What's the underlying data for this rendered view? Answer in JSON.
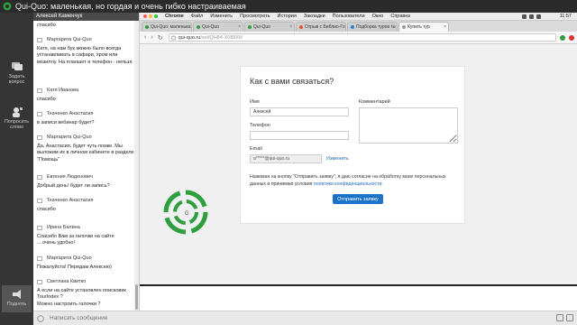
{
  "webinar": {
    "title": "Qui-Quo: маленькая, но гордая и очень гибко настраиваемая",
    "brand_color": "#2e9f3e"
  },
  "left_tools": {
    "ask_label": "Задать вопрос",
    "speak_label": "Попросить слово",
    "raise_label": "Поднять"
  },
  "chat": {
    "header": "Алексей Каменчук",
    "messages": [
      {
        "name": "",
        "text": "спасибо"
      },
      {
        "name": "Маргарита Qui-Quo",
        "text": "Катя, на нам бук можно было всегда устанавливать в сафари, хром или мозиллу. На планшет и телефон - нельзя."
      },
      {
        "name": "Катя Иванова",
        "text": "спасибо"
      },
      {
        "name": "Ткаченко Анастасия",
        "text": "в записи вебинар будет?"
      },
      {
        "name": "Маргарита Qui-Quo",
        "text": "Да, Анастасия, будет чуть позже. Мы выложим их в личном кабинете в разделе \"Помощь\""
      },
      {
        "name": "Евгения Люденович",
        "text": "Добрый день! будет ли запись?"
      },
      {
        "name": "Ткаченко Анастасия",
        "text": "спасибо"
      },
      {
        "name": "Ирина Балина",
        "text": "Спасибо Вам за галочки на сайте ....очень удобно!"
      },
      {
        "name": "Маргарита Qui-Quo",
        "text": "Пожалуйста! Передам Алексею)"
      },
      {
        "name": "Светлана Квитко",
        "text": "А если на сайте установлен поисковик TourIndex ?"
      },
      {
        "name": "",
        "text": "Можно настроить галочки ?"
      }
    ],
    "input_placeholder": "Написать сообщение"
  },
  "browser": {
    "menu": [
      "Chrome",
      "Файл",
      "Изменить",
      "Просмотреть",
      "История",
      "Закладки",
      "Пользователи",
      "Окно",
      "Справка"
    ],
    "clock": "11:57",
    "tabs": [
      {
        "label": "Qui-Quo: маленька",
        "color": "#2e9f3e"
      },
      {
        "label": "Qui-Quo",
        "color": "#2e9f3e"
      },
      {
        "label": "Qui-Quo",
        "color": "#2e9f3e"
      },
      {
        "label": "Отрыв с Библио-Глоб",
        "color": "#e0562f"
      },
      {
        "label": "Подборка туров № С",
        "color": "#2e7fd0"
      },
      {
        "label": "Купить тур",
        "color": "#999999"
      }
    ],
    "url_host": "qui-quo.ru",
    "url_path": "/sel/QH84-X088/0#"
  },
  "form": {
    "title": "Как с вами связаться?",
    "name_label": "Имя",
    "name_value": "Алексей",
    "phone_label": "Телефон",
    "phone_value": "",
    "email_label": "Email",
    "email_value": "a*****@qui-quo.ru",
    "change_link": "Изменить",
    "comment_label": "Комментарий",
    "consent_text": "Нажимая на кнопку \"Отправить заявку\", я даю согласие на обработку моих персональных данных и принимаю условия",
    "consent_link": "политики конфиденциальности.",
    "submit_label": "Отправить заявку",
    "accent": "#1a73c8"
  }
}
